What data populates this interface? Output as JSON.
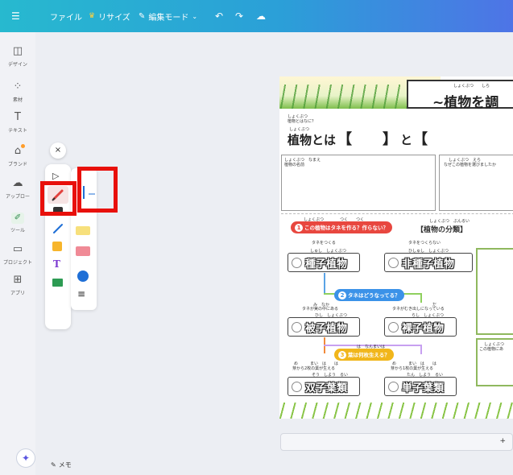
{
  "topbar": {
    "menu_icon": "menu-icon",
    "file_label": "ファイル",
    "resize_label": "リサイズ",
    "edit_mode_label": "編集モード",
    "undo_icon": "undo-icon",
    "redo_icon": "redo-icon",
    "cloud_icon": "cloud-sync-icon",
    "colors": {
      "start": "#27b9cf",
      "end": "#4e74e6"
    }
  },
  "sidebar": {
    "items": [
      {
        "label": "デザイン",
        "icon": "layout-icon"
      },
      {
        "label": "素材",
        "icon": "elements-icon"
      },
      {
        "label": "テキスト",
        "icon": "text-icon"
      },
      {
        "label": "ブランド",
        "icon": "brand-icon"
      },
      {
        "label": "アップロー",
        "icon": "upload-icon"
      },
      {
        "label": "ツール",
        "icon": "draw-tool-icon"
      },
      {
        "label": "プロジェクト",
        "icon": "folder-icon"
      },
      {
        "label": "アプリ",
        "icon": "apps-icon"
      }
    ]
  },
  "tool_panel": {
    "close_label": "×",
    "tools": [
      "select-pointer",
      "pen",
      "eraser",
      "line",
      "sticky-note",
      "text",
      "table"
    ],
    "sub_tools": [
      "pen-tip",
      "marker",
      "highlighter",
      "color-swatch",
      "stroke-weight"
    ],
    "highlight_color": "#e8100b",
    "swatch_color": "#1f6fd6"
  },
  "bottom": {
    "memo_label": "メモ",
    "plus_label": "+"
  },
  "worksheet": {
    "title": "~植物を調",
    "title_ruby": "しょくぶつ　　しら",
    "q1_small": "植物とはなに？",
    "q1_small_ruby": "しょくぶつ",
    "q1_ruby": "しょくぶつ",
    "q1": "植物とは",
    "bracket_open": "【",
    "bracket_close": "】",
    "to": "と",
    "col1_label": "植物の名前",
    "col1_ruby": "しょくぶつ　なまえ",
    "col2_label": "なぜこの植物を選びましたか",
    "col2_ruby": "しょくぶつ　えら",
    "section1": "この植物はタネを作る？作らない？",
    "section1_ruby": "しょくぶつ　　　　つく　　つく",
    "section1_num": "1",
    "classification": "【植物の分類】",
    "classification_ruby": "しょくぶつ　ぶんるい",
    "makes_seeds": "タネをつくる",
    "no_seeds": "タネをつくらない",
    "seed_plant_ruby": "しゅし　しょくぶつ",
    "seed_plant": "種子植物",
    "non_seed_ruby": "ひしゅし　しょくぶつ",
    "non_seed_plant": "非種子植物",
    "section2": "タネはどうなってる？",
    "section2_num": "2",
    "in_fruit": "タネが実の中にある",
    "in_fruit_ruby": "み　なか",
    "exposed": "タネがむき出しになっている",
    "exposed_ruby": "だ",
    "angiosperm_ruby": "ひし　しょくぶつ",
    "angiosperm": "被子植物",
    "gymnosperm_ruby": "らし　しょくぶつ",
    "gymnosperm": "裸子植物",
    "section3": "葉は何枚生える？",
    "section3_ruby": "は　なんまいは",
    "section3_num": "3",
    "two_leaves": "芽から2枚の葉が生える",
    "two_leaves_ruby": "め　　　まい　は　　は",
    "one_leaf": "芽から1枚の葉が生える",
    "one_leaf_ruby": "め　　　まい　は　　は",
    "dicot_ruby": "そう　しよう　るい",
    "dicot": "双子葉類",
    "monocot_ruby": "たん　しよう　るい",
    "monocot": "単子葉類",
    "side_label": "この植物にあ",
    "side_ruby": "しょくぶつ"
  }
}
